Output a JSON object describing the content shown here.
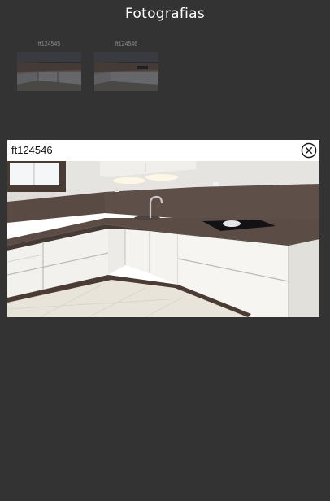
{
  "header": {
    "title": "Fotografias"
  },
  "gallery": {
    "thumbnails": [
      {
        "label": "ft124545"
      },
      {
        "label": "ft124546"
      }
    ]
  },
  "modal": {
    "title": "ft124546",
    "close_icon": "close-circle-icon"
  },
  "colors": {
    "background": "#333333",
    "modal_background": "#ffffff",
    "title_text": "#ffffff",
    "thumbnail_label": "#8d8d8d"
  }
}
